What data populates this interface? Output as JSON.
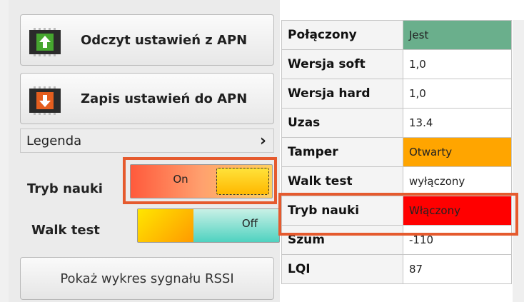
{
  "buttons": {
    "read": "Odczyt ustawień z APN",
    "write": "Zapis ustawień do APN",
    "rssi": "Pokaż wykres sygnału RSSI"
  },
  "legend": {
    "label": "Legenda",
    "chevron": "›"
  },
  "learn_mode": {
    "label": "Tryb nauki",
    "toggle_text": "On",
    "state": "on"
  },
  "walk_test": {
    "label": "Walk test",
    "toggle_text": "Off",
    "state": "off"
  },
  "status": [
    {
      "key": "Połączony",
      "value": "Jest",
      "color": "#6aaf8c"
    },
    {
      "key": "Wersja soft",
      "value": "1,0",
      "color": "#ffffff"
    },
    {
      "key": "Wersja hard",
      "value": "1,0",
      "color": "#ffffff"
    },
    {
      "key": "Uzas",
      "value": "13.4",
      "color": "#ffffff"
    },
    {
      "key": "Tamper",
      "value": "Otwarty",
      "color": "#ffa500"
    },
    {
      "key": "Walk test",
      "value": "wyłączony",
      "color": "#ffffff"
    },
    {
      "key": "Tryb nauki",
      "value": "Włączony",
      "color": "#ff0000"
    },
    {
      "key": "Szum",
      "value": "-110",
      "color": "#ffffff"
    },
    {
      "key": "LQI",
      "value": "87",
      "color": "#ffffff"
    }
  ],
  "icons": {
    "read": "chip-upload-icon",
    "write": "chip-download-icon",
    "legend": "chevron-right-icon"
  }
}
